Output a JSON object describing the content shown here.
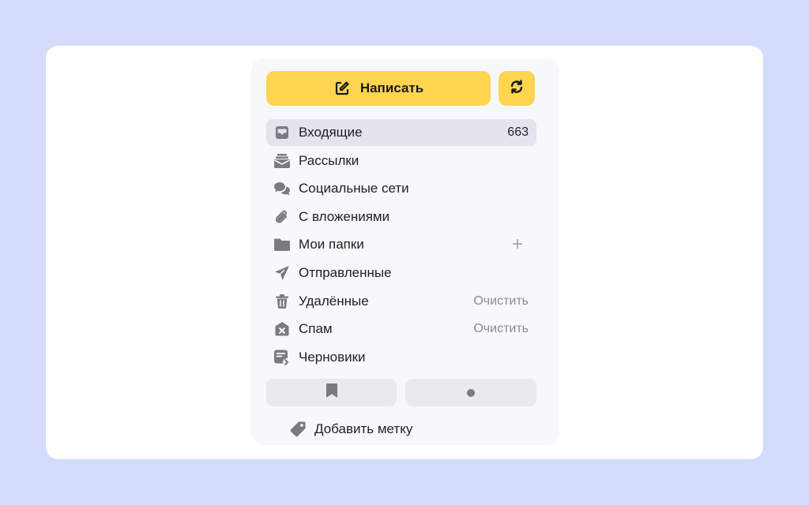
{
  "toolbar": {
    "compose_label": "Написать",
    "compose_icon": "edit-icon",
    "refresh_icon": "refresh-icon"
  },
  "folders": {
    "inbox": {
      "label": "Входящие",
      "count": "663",
      "icon": "inbox-icon"
    },
    "newsletters": {
      "label": "Рассылки",
      "icon": "newsletters-icon"
    },
    "social": {
      "label": "Социальные сети",
      "icon": "chat-bubbles-icon"
    },
    "attachments": {
      "label": "С вложениями",
      "icon": "paperclip-icon"
    },
    "my_folders": {
      "label": "Мои папки",
      "action": "+",
      "icon": "folder-icon"
    },
    "sent": {
      "label": "Отправленные",
      "icon": "send-icon"
    },
    "trash": {
      "label": "Удалённые",
      "action": "Очистить",
      "icon": "trash-icon"
    },
    "spam": {
      "label": "Спам",
      "action": "Очистить",
      "icon": "spam-icon"
    },
    "drafts": {
      "label": "Черновики",
      "icon": "drafts-icon"
    }
  },
  "filters": {
    "bookmark_icon": "bookmark-icon",
    "unread_icon": "unread-dot-icon"
  },
  "labels": {
    "add_label": "Добавить метку",
    "add_icon": "tag-icon"
  },
  "colors": {
    "background": "#d4dbfd",
    "accent": "#ffd44f",
    "active_row": "#e3e5ed",
    "icon": "#7a7a80"
  }
}
